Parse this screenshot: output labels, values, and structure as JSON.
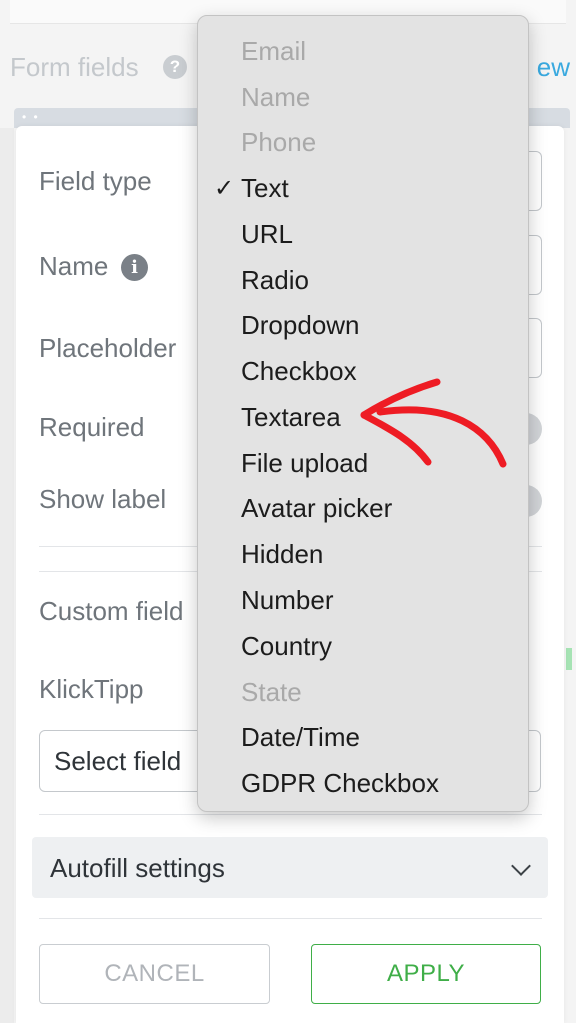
{
  "background": {
    "section_title": "Form fields",
    "help_icon": "question-circle-icon",
    "new_link": "New"
  },
  "dialog": {
    "field_type_label": "Field type",
    "name_label": "Name",
    "name_info_icon": "info-icon",
    "placeholder_label": "Placeholder",
    "required_label": "Required",
    "show_label_label": "Show label",
    "custom_field_label": "Custom field",
    "klicktipp_label": "KlickTipp",
    "select_field_value": "Select field",
    "autofill_label": "Autofill settings",
    "cancel_label": "CANCEL",
    "apply_label": "APPLY"
  },
  "dropdown": {
    "selected": "Text",
    "check_mark": "✓",
    "options": [
      {
        "label": "Email",
        "disabled": true
      },
      {
        "label": "Name",
        "disabled": true
      },
      {
        "label": "Phone",
        "disabled": true
      },
      {
        "label": "Text",
        "disabled": false
      },
      {
        "label": "URL",
        "disabled": false
      },
      {
        "label": "Radio",
        "disabled": false
      },
      {
        "label": "Dropdown",
        "disabled": false
      },
      {
        "label": "Checkbox",
        "disabled": false
      },
      {
        "label": "Textarea",
        "disabled": false
      },
      {
        "label": "File upload",
        "disabled": false
      },
      {
        "label": "Avatar picker",
        "disabled": false
      },
      {
        "label": "Hidden",
        "disabled": false
      },
      {
        "label": "Number",
        "disabled": false
      },
      {
        "label": "Country",
        "disabled": false
      },
      {
        "label": "State",
        "disabled": true
      },
      {
        "label": "Date/Time",
        "disabled": false
      },
      {
        "label": "GDPR Checkbox",
        "disabled": false
      }
    ]
  },
  "annotation": {
    "arrow_color": "#ee1c24",
    "points_to": "Textarea"
  },
  "colors": {
    "apply_green": "#3fae48",
    "link_blue": "#3aa9df"
  }
}
